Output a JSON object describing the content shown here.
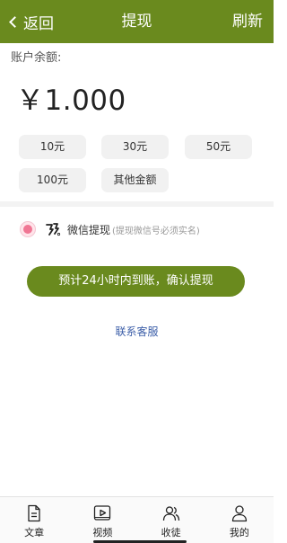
{
  "header": {
    "back_label": "返回",
    "title": "提现",
    "refresh_label": "刷新"
  },
  "balance": {
    "label": "账户余额:",
    "amount": "￥1.000"
  },
  "amount_options": [
    "10元",
    "30元",
    "50元",
    "100元",
    "其他金额"
  ],
  "payment": {
    "method_label": "微信提现",
    "method_note": "(提现微信号必须实名)"
  },
  "confirm_button": "预计24小时内到账，确认提现",
  "service_link": "联系客服",
  "tabbar": {
    "items": [
      "文章",
      "视频",
      "收徒",
      "我的"
    ]
  },
  "colors": {
    "brand": "#6a8a1e",
    "radio": "#f07694",
    "link": "#3c5ea8"
  }
}
